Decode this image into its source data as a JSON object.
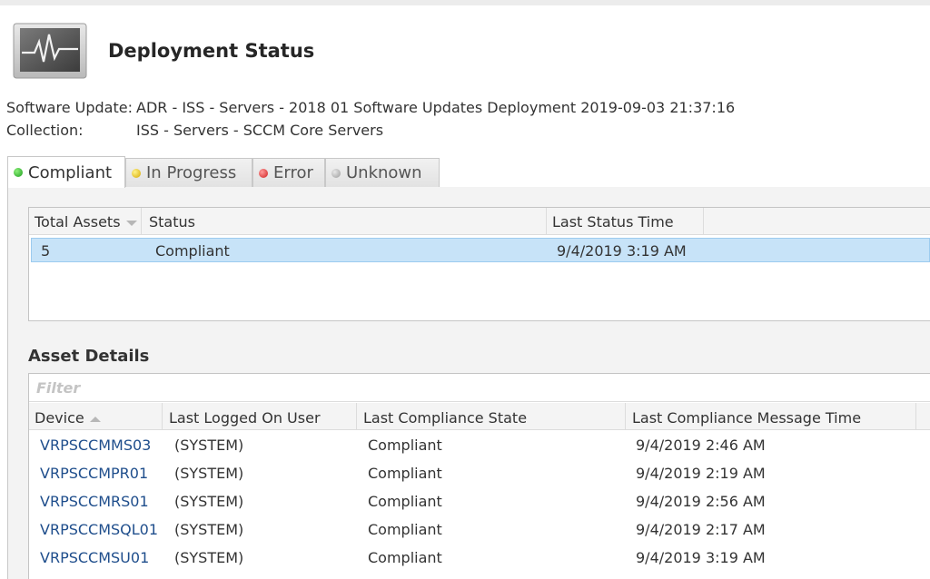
{
  "header": {
    "title": "Deployment Status",
    "software_update_label": "Software Update:",
    "software_update_value": "ADR - ISS - Servers - 2018 01 Software Updates Deployment 2019-09-03 21:37:16",
    "collection_label": "Collection:",
    "collection_value": "ISS - Servers - SCCM Core Servers",
    "icon": "monitor-heartbeat-icon"
  },
  "tabs": [
    {
      "label": "Compliant",
      "status_color": "#1c9c1c",
      "active": true
    },
    {
      "label": "In Progress",
      "status_color": "#d6a800",
      "active": false
    },
    {
      "label": "Error",
      "status_color": "#cf1e1e",
      "active": false
    },
    {
      "label": "Unknown",
      "status_color": "#9a9a9a",
      "active": false
    }
  ],
  "summary": {
    "columns": [
      "Total Assets",
      "Status",
      "Last Status Time"
    ],
    "rows": [
      {
        "total_assets": "5",
        "status": "Compliant",
        "last_status_time": "9/4/2019 3:19 AM"
      }
    ]
  },
  "asset_details": {
    "heading": "Asset Details",
    "filter_placeholder": "Filter",
    "columns": [
      "Device",
      "Last Logged On User",
      "Last Compliance State",
      "Last Compliance Message Time"
    ],
    "rows": [
      {
        "device": "VRPSCCMMS03",
        "user": "(SYSTEM)",
        "state": "Compliant",
        "time": "9/4/2019 2:46 AM"
      },
      {
        "device": "VRPSCCMPR01",
        "user": "(SYSTEM)",
        "state": "Compliant",
        "time": "9/4/2019 2:19 AM"
      },
      {
        "device": "VRPSCCMRS01",
        "user": "(SYSTEM)",
        "state": "Compliant",
        "time": "9/4/2019 2:56 AM"
      },
      {
        "device": "VRPSCCMSQL01",
        "user": "(SYSTEM)",
        "state": "Compliant",
        "time": "9/4/2019 2:17 AM"
      },
      {
        "device": "VRPSCCMSU01",
        "user": "(SYSTEM)",
        "state": "Compliant",
        "time": "9/4/2019 3:19 AM"
      }
    ]
  },
  "colors": {
    "selected_row": "#c7e3f8",
    "device_link": "#1f4e8c"
  }
}
